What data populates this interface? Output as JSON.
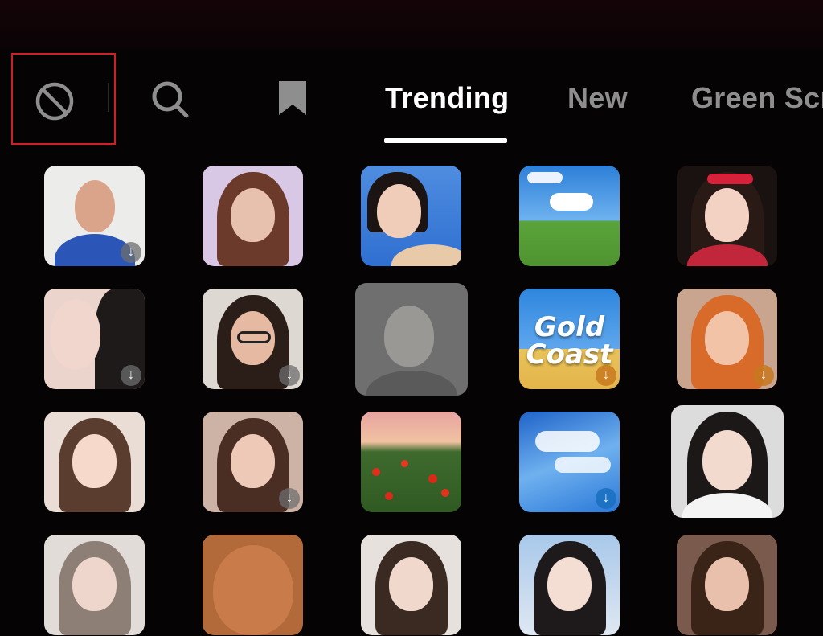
{
  "toolbar": {
    "icons": [
      "no-effect-icon",
      "search-icon",
      "bookmark-icon"
    ],
    "tabs": [
      {
        "label": "Trending",
        "active": true
      },
      {
        "label": "New",
        "active": false
      },
      {
        "label": "Green Scr",
        "active": false
      }
    ]
  },
  "effects": {
    "gold_coast_line1": "Gold",
    "gold_coast_line2": "Coast"
  },
  "colors": {
    "highlight": "#d21f26",
    "active_tab": "#ffffff",
    "inactive_tab": "#8e8e8e",
    "background": "#050304"
  }
}
